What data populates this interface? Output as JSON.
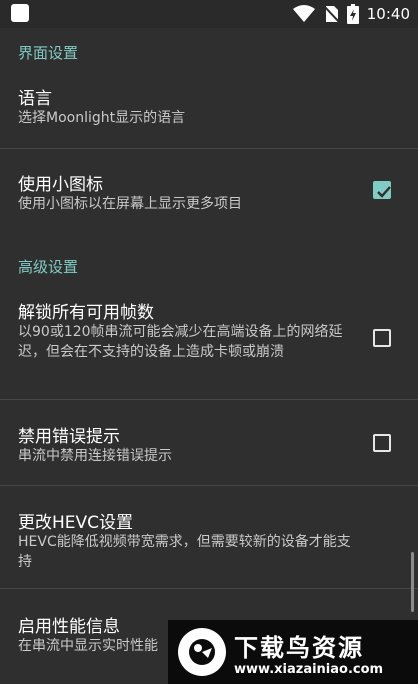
{
  "status_bar": {
    "time": "10:40",
    "icons": [
      "app-notification-icon",
      "wifi-icon",
      "no-sim-icon",
      "battery-charging-icon"
    ]
  },
  "sections": {
    "ui_settings": "界面设置",
    "advanced_settings": "高级设置"
  },
  "prefs": {
    "language": {
      "title": "语言",
      "summary": "选择Moonlight显示的语言"
    },
    "small_icons": {
      "title": "使用小图标",
      "summary": "使用小图标以在屏幕上显示更多项目",
      "checked": true
    },
    "unlock_fps": {
      "title": "解锁所有可用帧数",
      "summary": "以90或120帧串流可能会减少在高端设备上的网络延迟，但会在不支持的设备上造成卡顿或崩溃",
      "checked": false
    },
    "disable_errors": {
      "title": "禁用错误提示",
      "summary": "串流中禁用连接错误提示",
      "checked": false
    },
    "hevc": {
      "title": "更改HEVC设置",
      "summary": "HEVC能降低视频带宽需求，但需要较新的设备才能支持"
    },
    "perf_info": {
      "title": "启用性能信息",
      "summary": "在串流中显示实时性能"
    }
  },
  "watermark": {
    "title": "下载鸟资源",
    "url": "www.xiazainiao.com"
  },
  "colors": {
    "accent": "#80cbc4",
    "background": "#2f2f2f",
    "divider": "#464646"
  }
}
